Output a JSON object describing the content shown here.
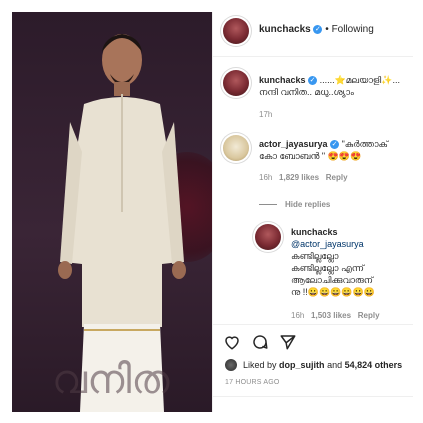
{
  "header": {
    "username": "kunchacks",
    "follow_status": "Following",
    "separator": "•"
  },
  "caption": {
    "username": "kunchacks",
    "text_line1": "......⭐മലയാളി✨...",
    "text_line2": "നന്ദി വനിത.. മധു..ശ്യാം",
    "time": "17h"
  },
  "comment": {
    "username": "actor_jayasurya",
    "text_line1": "\"കുർത്താക്",
    "text_line2": "കോ ബോബൻ \" 😍😍😍",
    "time": "16h",
    "likes": "1,829 likes",
    "reply": "Reply",
    "hide_replies": "Hide replies"
  },
  "reply": {
    "username": "kunchacks",
    "mention": "@actor_jayasurya",
    "text_line1": "കണ്ടില്ലല്ലോ",
    "text_line2": "കണ്ടില്ലല്ലോ എന്ന്",
    "text_line3": "ആലോചിക്കുവാരുന്",
    "text_line4": "നു !!😀😀😀😀😀😀",
    "time": "16h",
    "likes": "1,503 likes",
    "reply": "Reply"
  },
  "actions": {
    "like_icon": "heart-icon",
    "comment_icon": "comment-icon",
    "share_icon": "share-icon"
  },
  "likes_line": {
    "prefix": "Liked by",
    "user": "dop_sujith",
    "middle": "and",
    "count": "54,824 others"
  },
  "timestamp": "17 HOURS AGO",
  "photo": {
    "watermark": "വനിത"
  }
}
